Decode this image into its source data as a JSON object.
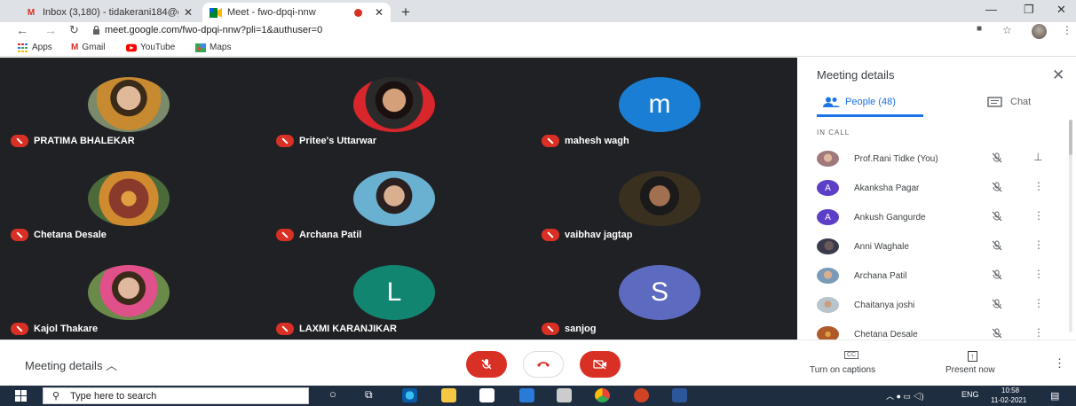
{
  "browser": {
    "tabs": [
      {
        "title": "Inbox (3,180) - tidakerani184@g",
        "favicon": "gmail-icon",
        "active": false
      },
      {
        "title": "Meet - fwo-dpqi-nnw",
        "favicon": "meet-icon",
        "active": true
      }
    ],
    "new_tab": "+",
    "url": "meet.google.com/fwo-dpqi-nnw?pli=1&authuser=0",
    "bookmarks": [
      "Apps",
      "Gmail",
      "YouTube",
      "Maps"
    ]
  },
  "grid": {
    "tiles": [
      {
        "name": "PRATIMA BHALEKAR",
        "avatar": "photo",
        "color": "#7a8a6a"
      },
      {
        "name": "Pritee's Uttarwar",
        "avatar": "photo",
        "color": "#d9262c"
      },
      {
        "name": "mahesh wagh",
        "avatar": "letter",
        "letter": "m",
        "color": "#1a7fd4"
      },
      {
        "name": "Chetana Desale",
        "avatar": "photo",
        "color": "#8a5a3a"
      },
      {
        "name": "Archana Patil",
        "avatar": "photo",
        "color": "#4a93b8"
      },
      {
        "name": "vaibhav jagtap",
        "avatar": "photo",
        "color": "#3a3020"
      },
      {
        "name": "Kajol Thakare",
        "avatar": "photo",
        "color": "#c9a86a"
      },
      {
        "name": "LAXMI KARANJIKAR",
        "avatar": "letter",
        "letter": "L",
        "color": "#128571"
      },
      {
        "name": "sanjog",
        "avatar": "letter",
        "letter": "S",
        "color": "#5c6bc0"
      }
    ]
  },
  "panel": {
    "title": "Meeting details",
    "tab_people": "People (48)",
    "tab_chat": "Chat",
    "section": "IN CALL",
    "people": [
      {
        "name": "Prof.Rani Tidke (You)",
        "avatar": "photo",
        "color": "#a07a7a",
        "action": "pin"
      },
      {
        "name": "Akanksha Pagar",
        "avatar": "letter",
        "letter": "A",
        "color": "#5c3ec7",
        "action": "more"
      },
      {
        "name": "Ankush Gangurde",
        "avatar": "letter",
        "letter": "A",
        "color": "#5c3ec7",
        "action": "more"
      },
      {
        "name": "Anni Waghale",
        "avatar": "photo",
        "color": "#3a3a4a",
        "action": "more"
      },
      {
        "name": "Archana Patil",
        "avatar": "photo",
        "color": "#7a9ab8",
        "action": "more"
      },
      {
        "name": "Chaitanya joshi",
        "avatar": "photo",
        "color": "#b8c4cc",
        "action": "more"
      },
      {
        "name": "Chetana Desale",
        "avatar": "photo",
        "color": "#b05a2a",
        "action": "more"
      }
    ]
  },
  "controls": {
    "meeting_details": "Meeting details",
    "captions": "Turn on captions",
    "present": "Present now",
    "accent_red": "#d93025"
  },
  "taskbar": {
    "search_placeholder": "Type here to search",
    "lang": "ENG",
    "time": "10:58",
    "date": "11-02-2021"
  }
}
